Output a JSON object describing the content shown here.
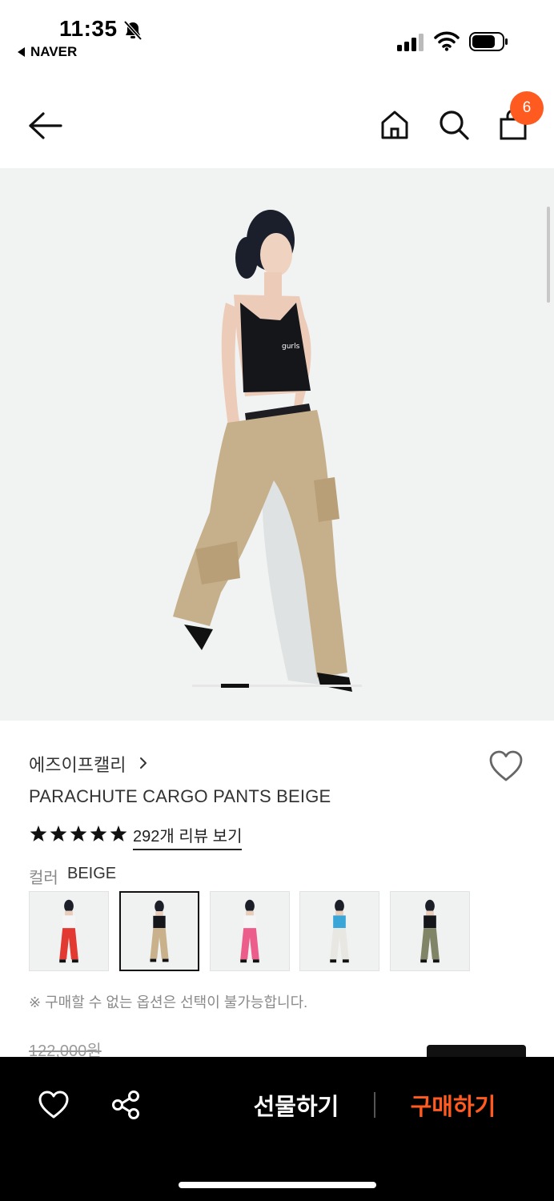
{
  "status_bar": {
    "time": "11:35",
    "back_app": "NAVER",
    "icons": [
      "bell-off-icon",
      "signal-icon",
      "wifi-icon",
      "battery-icon"
    ]
  },
  "header": {
    "icons": [
      "back-arrow-icon",
      "home-icon",
      "search-icon",
      "shopping-bag-icon"
    ],
    "cart_count": "6",
    "badge_color": "#ff5a1f"
  },
  "gallery": {
    "image": "model wearing black cami top and beige parachute cargo pants",
    "page_index": 1,
    "background": "#f1f3f3"
  },
  "product": {
    "brand": "에즈이프캘리",
    "title": "PARACHUTE CARGO PANTS BEIGE",
    "rating_stars": 5,
    "reviews_link": "292개 리뷰 보기",
    "color_label": "컬러",
    "color_value": "BEIGE",
    "swatches": [
      {
        "name": "red",
        "color": "#e23a32",
        "selected": false
      },
      {
        "name": "beige",
        "color": "#c9b18c",
        "selected": true
      },
      {
        "name": "pink",
        "color": "#ec5d8c",
        "selected": false
      },
      {
        "name": "white",
        "color": "#e9e7e2",
        "selected": false
      },
      {
        "name": "khaki",
        "color": "#7f8566",
        "selected": false
      }
    ],
    "notice": "※ 구매할 수 없는 옵션은 선택이 불가능합니다.",
    "original_price": "122,000원"
  },
  "bottom_bar": {
    "gift_label": "선물하기",
    "buy_label": "구매하기",
    "icons": [
      "heart-icon",
      "share-icon"
    ],
    "accent": "#ff5a1f"
  }
}
